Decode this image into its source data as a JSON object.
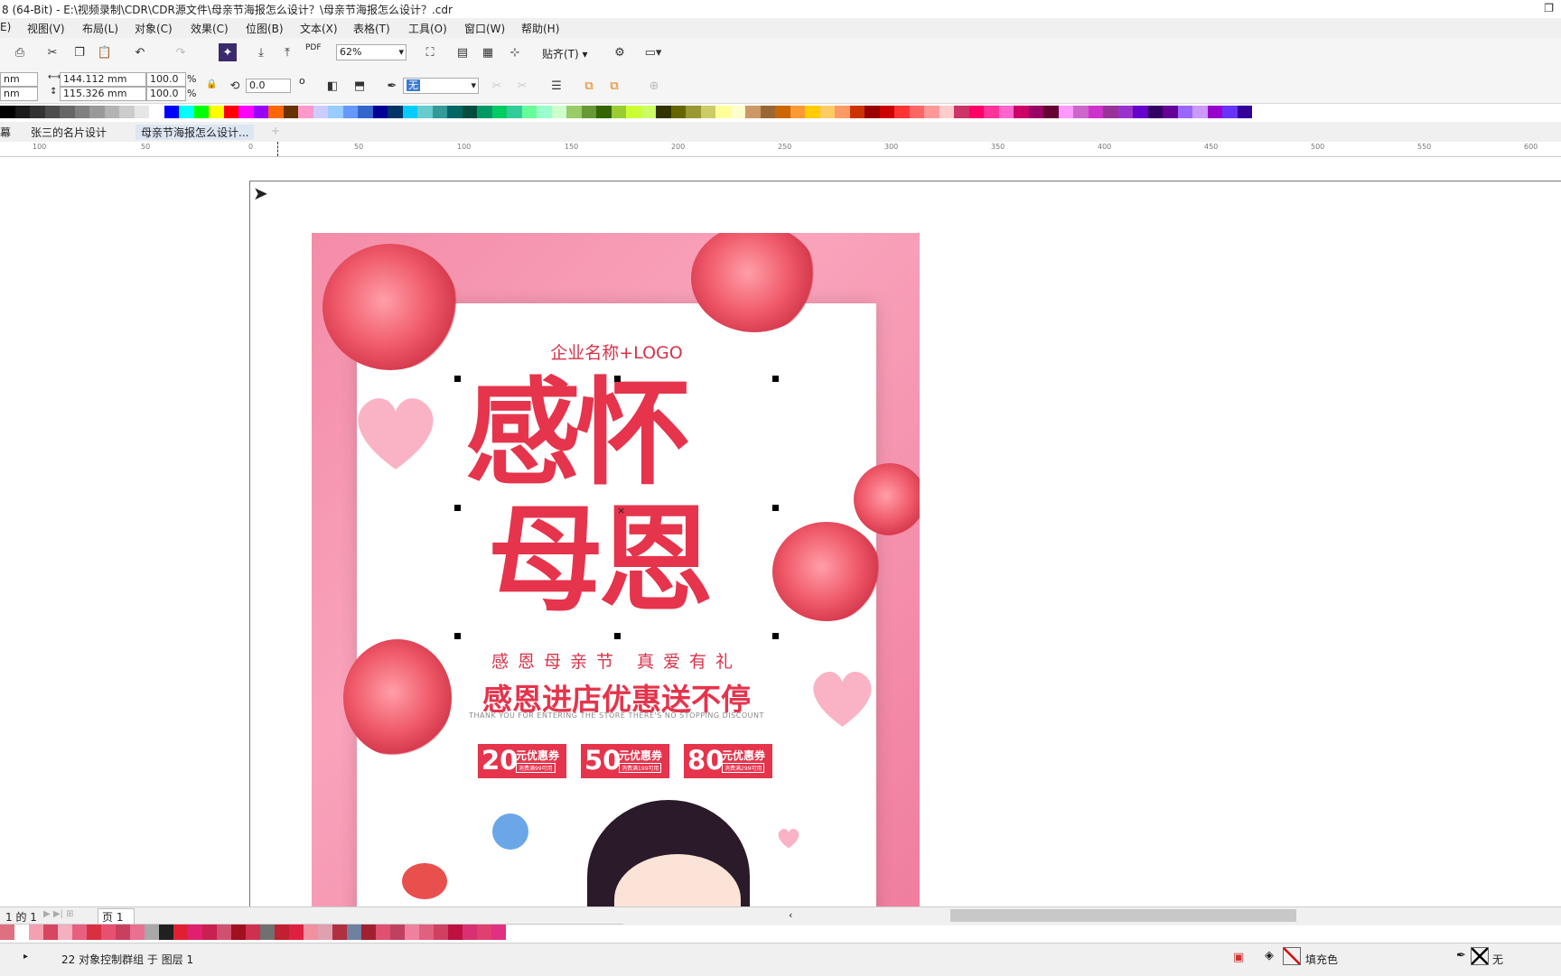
{
  "titlebar": {
    "title": "8 (64-Bit) - E:\\视频录制\\CDR\\CDR源文件\\母亲节海报怎么设计？\\母亲节海报怎么设计？.cdr"
  },
  "menu": [
    "E)",
    "视图(V)",
    "布局(L)",
    "对象(C)",
    "效果(C)",
    "位图(B)",
    "文本(X)",
    "表格(T)",
    "工具(O)",
    "窗口(W)",
    "帮助(H)"
  ],
  "toolbar": {
    "zoom": "62%",
    "snap": "贴齐(T)",
    "pdf": "PDF"
  },
  "property": {
    "x_unit": "nm",
    "y_unit": "nm",
    "width": "144.112 mm",
    "height": "115.326 mm",
    "scale_w": "100.0",
    "scale_h": "100.0",
    "pct": "%",
    "rotation": "0.0",
    "degree": "o",
    "outline": "无"
  },
  "palette": [
    "#000000",
    "#1a1a1a",
    "#333333",
    "#4d4d4d",
    "#666666",
    "#808080",
    "#999999",
    "#b3b3b3",
    "#cccccc",
    "#e6e6e6",
    "#ffffff",
    "#0000ff",
    "#00ffff",
    "#00ff00",
    "#ffff00",
    "#ff0000",
    "#ff00ff",
    "#9900ff",
    "#ff6600",
    "#663300",
    "#ff99cc",
    "#ccccff",
    "#99ccff",
    "#6699ff",
    "#3366cc",
    "#000099",
    "#003366",
    "#00ccff",
    "#66cccc",
    "#339999",
    "#006666",
    "#004d40",
    "#009966",
    "#00cc66",
    "#33cc99",
    "#66ff99",
    "#99ffcc",
    "#ccffcc",
    "#99cc66",
    "#669933",
    "#336600",
    "#99cc33",
    "#ccff33",
    "#ccff66",
    "#333300",
    "#666600",
    "#999933",
    "#cccc66",
    "#ffff99",
    "#ffffcc",
    "#cc9966",
    "#996633",
    "#cc6600",
    "#ff9933",
    "#ffcc00",
    "#ffcc66",
    "#ff9966",
    "#cc3300",
    "#990000",
    "#cc0000",
    "#ff3333",
    "#ff6666",
    "#ff9999",
    "#ffcccc",
    "#cc3366",
    "#ff0066",
    "#ff3399",
    "#ff66cc",
    "#cc0066",
    "#990066",
    "#660033",
    "#ff99ff",
    "#cc66cc",
    "#cc33cc",
    "#993399",
    "#9933cc",
    "#6600cc",
    "#330066",
    "#660099",
    "#9966ff",
    "#cc99ff",
    "#9900cc",
    "#6633ff",
    "#330099"
  ],
  "doctabs": [
    "幕",
    "张三的名片设计",
    "母亲节海报怎么设计..."
  ],
  "ruler": [
    "100",
    "50",
    "0",
    "50",
    "100",
    "150",
    "200",
    "250",
    "300",
    "350",
    "400",
    "450",
    "500",
    "550",
    "600"
  ],
  "poster": {
    "company": "企业名称+LOGO",
    "title_line1": "感怀",
    "title_line2": "母恩",
    "subtitle": "感恩母亲节  真爱有礼",
    "headline": "感恩进店优惠送不停",
    "english": "THANK YOU FOR ENTERING THE STORE THERE'S NO STOPPING DISCOUNT",
    "coupons": [
      {
        "amount": "20",
        "label": "元优惠券",
        "cond": "消费满99可用"
      },
      {
        "amount": "50",
        "label": "元优惠券",
        "cond": "消费满199可用"
      },
      {
        "amount": "80",
        "label": "元优惠券",
        "cond": "消费满299可用"
      }
    ]
  },
  "pagenav": {
    "count": "1 的 1",
    "page": "页 1"
  },
  "bottompalette": [
    "#e07080",
    "#ffffff",
    "#f4a0b0",
    "#d84560",
    "#f5b0c0",
    "#e86080",
    "#d83040",
    "#e85070",
    "#c84060",
    "#e87090",
    "#a8a8a8",
    "#202020",
    "#e02030",
    "#e0206f",
    "#c82050",
    "#d05070",
    "#a01020",
    "#d03050",
    "#707070",
    "#c02030",
    "#e02040",
    "#f090a0",
    "#e0a0b0",
    "#b03040",
    "#7080a0",
    "#a02030",
    "#e05070",
    "#c04060",
    "#f080a0",
    "#e06080",
    "#d04060",
    "#c01040",
    "#d83070",
    "#e04070",
    "#e03080"
  ],
  "status": {
    "message": "22 对象控制群组 于 图层 1",
    "fill": "填充色",
    "outline": "无"
  }
}
